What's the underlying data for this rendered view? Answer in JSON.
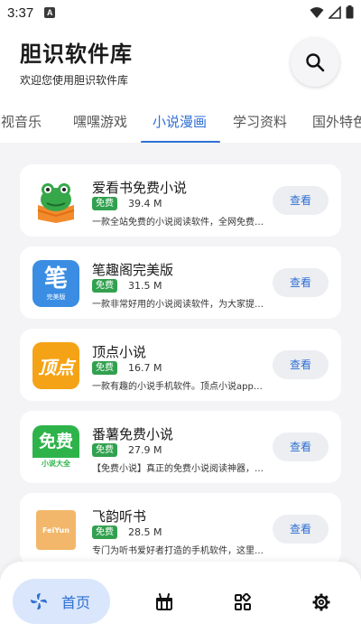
{
  "status_bar": {
    "time": "3:37",
    "notification_glyph": "A"
  },
  "header": {
    "title": "胆识软件库",
    "subtitle": "欢迎您使用胆识软件库",
    "search_icon": "search-icon"
  },
  "tabs": [
    {
      "label": "影视音乐",
      "active": false
    },
    {
      "label": "嘿嘿游戏",
      "active": false
    },
    {
      "label": "小说漫画",
      "active": true
    },
    {
      "label": "学习资料",
      "active": false
    },
    {
      "label": "国外特色",
      "active": false
    }
  ],
  "apps": [
    {
      "name": "爱看书免费小说",
      "badge": "免费",
      "size": "39.4 M",
      "description": "一款全站免费的小说阅读软件，全网免费小说随心看",
      "action": "查看",
      "icon": "frog-book-icon"
    },
    {
      "name": "笔趣阁完美版",
      "badge": "免费",
      "size": "31.5 M",
      "description": "一款非常好用的小说阅读软件，为大家提供海量小说",
      "action": "查看",
      "icon": "biquge-icon",
      "icon_text": "笔",
      "icon_subtext": "完美版"
    },
    {
      "name": "顶点小说",
      "badge": "免费",
      "size": "16.7 M",
      "description": "一款有趣的小说手机软件。顶点小说app提供海量小说",
      "action": "查看",
      "icon": "dingdian-icon",
      "icon_text": "顶点"
    },
    {
      "name": "番薯免费小说",
      "badge": "免费",
      "size": "27.9 M",
      "description": "【免费小说】真正的免费小说阅读神器，海量小说免费看",
      "action": "查看",
      "icon": "fanshu-icon",
      "icon_text": "免费",
      "icon_subtext": "小说大全"
    },
    {
      "name": "飞韵听书",
      "badge": "免费",
      "size": "28.5 M",
      "description": "专门为听书爱好者打造的手机软件，这里有海量有声小说",
      "action": "查看",
      "icon": "feiyun-icon",
      "icon_text": "FeiYun"
    }
  ],
  "bottom_nav": {
    "home_label": "首页",
    "items": [
      "home-icon",
      "gift-icon",
      "apps-icon",
      "settings-icon"
    ]
  },
  "colors": {
    "accent": "#2f6fd3",
    "badge_green": "#32a14f",
    "background": "#f4f4f6"
  }
}
